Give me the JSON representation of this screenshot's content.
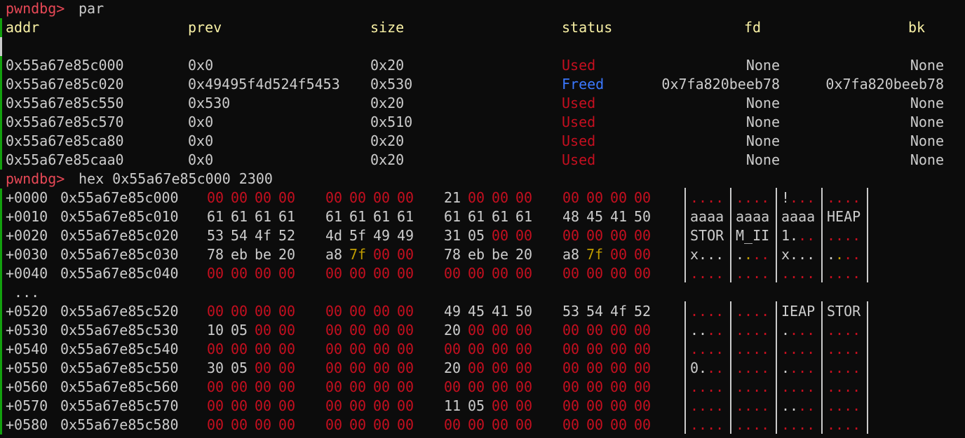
{
  "prompt": "pwndbg>",
  "command1": "par",
  "table": {
    "headers": [
      "addr",
      "prev",
      "size",
      "status",
      "fd",
      "bk"
    ],
    "rows": [
      [
        "0x55a67e85c000",
        "0x0",
        "0x20",
        "Used",
        "None",
        "None"
      ],
      [
        "0x55a67e85c020",
        "0x49495f4d524f5453",
        "0x530",
        "Freed",
        "0x7fa820beeb78",
        "0x7fa820beeb78"
      ],
      [
        "0x55a67e85c550",
        "0x530",
        "0x20",
        "Used",
        "None",
        "None"
      ],
      [
        "0x55a67e85c570",
        "0x0",
        "0x510",
        "Used",
        "None",
        "None"
      ],
      [
        "0x55a67e85ca80",
        "0x0",
        "0x20",
        "Used",
        "None",
        "None"
      ],
      [
        "0x55a67e85caa0",
        "0x0",
        "0x20",
        "Used",
        "None",
        "None"
      ]
    ]
  },
  "command2": "hex 0x55a67e85c000 2300",
  "hexdump": [
    {
      "off": "+0000",
      "addr": "0x55a67e85c000",
      "bytes": [
        "00",
        "00",
        "00",
        "00",
        "00",
        "00",
        "00",
        "00",
        "21",
        "00",
        "00",
        "00",
        "00",
        "00",
        "00",
        "00"
      ],
      "ascii": [
        "....",
        "....",
        "!...",
        "...."
      ]
    },
    {
      "off": "+0010",
      "addr": "0x55a67e85c010",
      "bytes": [
        "61",
        "61",
        "61",
        "61",
        "61",
        "61",
        "61",
        "61",
        "61",
        "61",
        "61",
        "61",
        "48",
        "45",
        "41",
        "50"
      ],
      "ascii": [
        "aaaa",
        "aaaa",
        "aaaa",
        "HEAP"
      ]
    },
    {
      "off": "+0020",
      "addr": "0x55a67e85c020",
      "bytes": [
        "53",
        "54",
        "4f",
        "52",
        "4d",
        "5f",
        "49",
        "49",
        "31",
        "05",
        "00",
        "00",
        "00",
        "00",
        "00",
        "00"
      ],
      "ascii": [
        "STOR",
        "M_II",
        "1...",
        "...."
      ]
    },
    {
      "off": "+0030",
      "addr": "0x55a67e85c030",
      "bytes": [
        "78",
        "eb",
        "be",
        "20",
        "a8",
        "7f",
        "00",
        "00",
        "78",
        "eb",
        "be",
        "20",
        "a8",
        "7f",
        "00",
        "00"
      ],
      "ascii": [
        "x...",
        "....",
        "x...",
        "...."
      ]
    },
    {
      "off": "+0040",
      "addr": "0x55a67e85c040",
      "bytes": [
        "00",
        "00",
        "00",
        "00",
        "00",
        "00",
        "00",
        "00",
        "00",
        "00",
        "00",
        "00",
        "00",
        "00",
        "00",
        "00"
      ],
      "ascii": [
        "....",
        "....",
        "....",
        "...."
      ]
    },
    {
      "ellipsis": " ..."
    },
    {
      "off": "+0520",
      "addr": "0x55a67e85c520",
      "bytes": [
        "00",
        "00",
        "00",
        "00",
        "00",
        "00",
        "00",
        "00",
        "49",
        "45",
        "41",
        "50",
        "53",
        "54",
        "4f",
        "52"
      ],
      "ascii": [
        "....",
        "....",
        "IEAP",
        "STOR"
      ]
    },
    {
      "off": "+0530",
      "addr": "0x55a67e85c530",
      "bytes": [
        "10",
        "05",
        "00",
        "00",
        "00",
        "00",
        "00",
        "00",
        "20",
        "00",
        "00",
        "00",
        "00",
        "00",
        "00",
        "00"
      ],
      "ascii": [
        "....",
        "....",
        "....",
        "...."
      ]
    },
    {
      "off": "+0540",
      "addr": "0x55a67e85c540",
      "bytes": [
        "00",
        "00",
        "00",
        "00",
        "00",
        "00",
        "00",
        "00",
        "00",
        "00",
        "00",
        "00",
        "00",
        "00",
        "00",
        "00"
      ],
      "ascii": [
        "....",
        "....",
        "....",
        "...."
      ]
    },
    {
      "off": "+0550",
      "addr": "0x55a67e85c550",
      "bytes": [
        "30",
        "05",
        "00",
        "00",
        "00",
        "00",
        "00",
        "00",
        "20",
        "00",
        "00",
        "00",
        "00",
        "00",
        "00",
        "00"
      ],
      "ascii": [
        "0...",
        "....",
        "....",
        "...."
      ]
    },
    {
      "off": "+0560",
      "addr": "0x55a67e85c560",
      "bytes": [
        "00",
        "00",
        "00",
        "00",
        "00",
        "00",
        "00",
        "00",
        "00",
        "00",
        "00",
        "00",
        "00",
        "00",
        "00",
        "00"
      ],
      "ascii": [
        "....",
        "....",
        "....",
        "...."
      ]
    },
    {
      "off": "+0570",
      "addr": "0x55a67e85c570",
      "bytes": [
        "00",
        "00",
        "00",
        "00",
        "00",
        "00",
        "00",
        "00",
        "11",
        "05",
        "00",
        "00",
        "00",
        "00",
        "00",
        "00"
      ],
      "ascii": [
        "....",
        "....",
        "....",
        "...."
      ]
    },
    {
      "off": "+0580",
      "addr": "0x55a67e85c580",
      "bytes": [
        "00",
        "00",
        "00",
        "00",
        "00",
        "00",
        "00",
        "00",
        "00",
        "00",
        "00",
        "00",
        "00",
        "00",
        "00",
        "00"
      ],
      "ascii": [
        "....",
        "....",
        "....",
        "...."
      ]
    }
  ],
  "colors": {
    "background": "#0c0c0c",
    "text": "#cccccc",
    "prompt": "#e74856",
    "header": "#f9f1a5",
    "used": "#c50f1f",
    "freed": "#3b78ff",
    "null_byte": "#c50f1f",
    "pointer_byte": "#c19c00",
    "gutter": "#13a10e"
  }
}
